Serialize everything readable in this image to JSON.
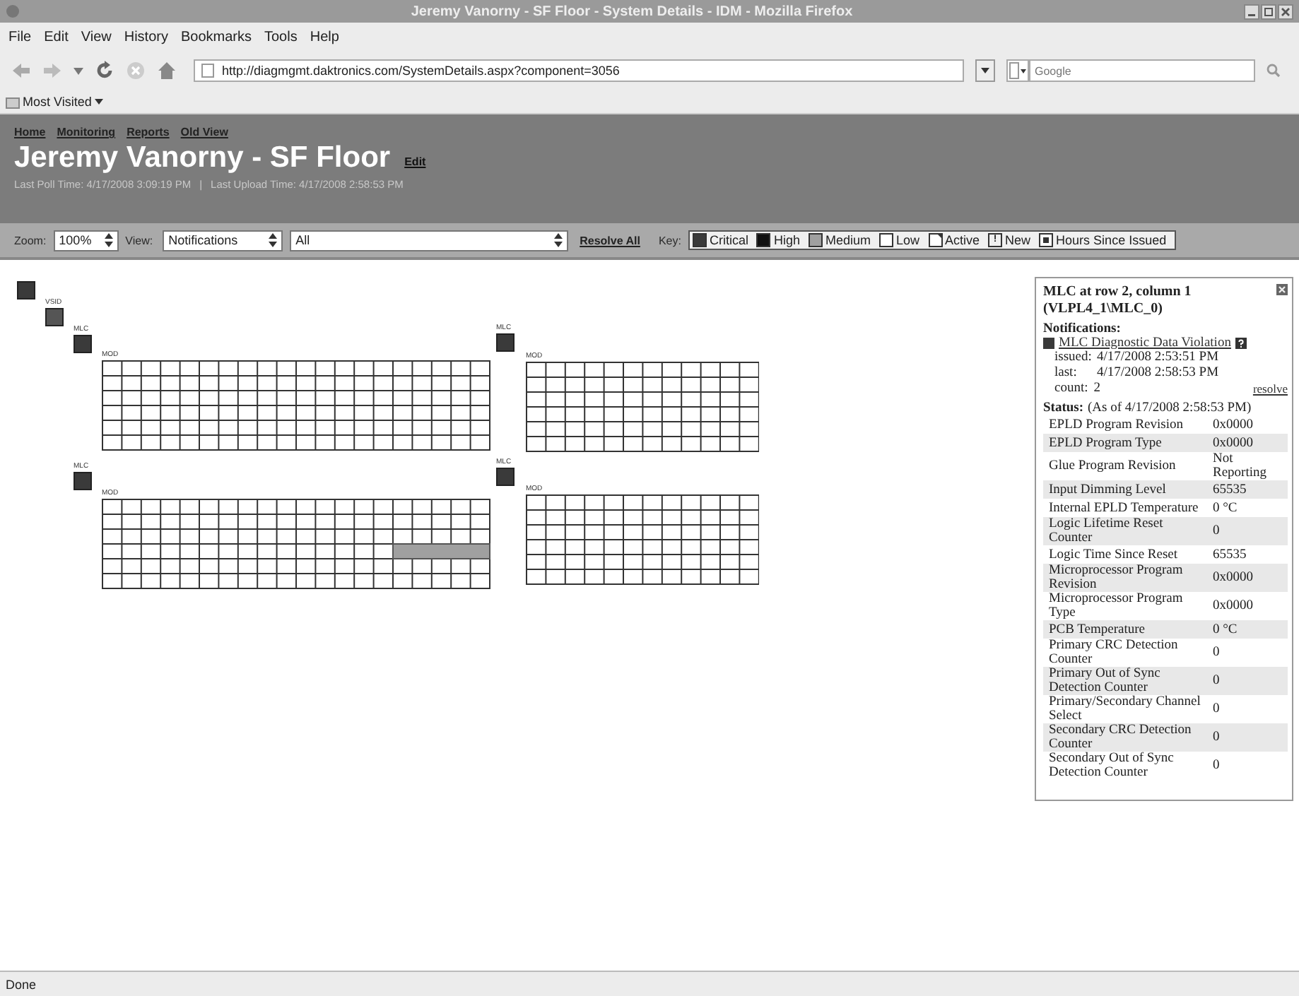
{
  "window": {
    "title": "Jeremy Vanorny - SF Floor - System Details - IDM - Mozilla Firefox"
  },
  "menu": [
    "File",
    "Edit",
    "View",
    "History",
    "Bookmarks",
    "Tools",
    "Help"
  ],
  "address": {
    "url": "http://diagmgmt.daktronics.com/SystemDetails.aspx?component=3056"
  },
  "search": {
    "placeholder": "Google"
  },
  "bookmarks": [
    "Most Visited"
  ],
  "header": {
    "nav_links": [
      "Home",
      "Monitoring",
      "Reports",
      "Old View"
    ],
    "title": "Jeremy Vanorny - SF Floor",
    "edit_link": "Edit",
    "last_poll": "Last Poll Time: 4/17/2008 3:09:19 PM",
    "separator": "|",
    "last_upload": "Last Upload Time: 4/17/2008 2:58:53 PM"
  },
  "toolbar": {
    "zoom_label": "Zoom:",
    "zoom": "100%",
    "view_label": "View:",
    "view": "Notifications",
    "filter": "All",
    "resolve_all": "Resolve All",
    "key_label": "Key:",
    "key": [
      {
        "kind": "swatch",
        "label": "Critical",
        "color": "#3a3a3a"
      },
      {
        "kind": "swatch",
        "label": "High",
        "color": "#111111"
      },
      {
        "kind": "swatch",
        "label": "Medium",
        "color": "#a0a0a0"
      },
      {
        "kind": "swatch",
        "label": "Low",
        "color": "#ffffff"
      },
      {
        "kind": "active",
        "label": "Active"
      },
      {
        "kind": "new",
        "label": "New",
        "mark": "!"
      },
      {
        "kind": "hours",
        "label": "Hours Since Issued"
      }
    ]
  },
  "diagram": {
    "nodes": [
      {
        "kind": "unit",
        "color": "#3a3a3a"
      },
      {
        "kind": "unit",
        "label": "VSID",
        "color": "#555555"
      },
      {
        "kind": "unit",
        "label": "MLC",
        "color": "#3a3a3a"
      },
      {
        "kind": "module",
        "label": "MOD",
        "alert": false
      },
      {
        "kind": "unit",
        "label": "MLC",
        "color": "#3a3a3a"
      },
      {
        "kind": "module",
        "label": "MOD",
        "alert": false
      },
      {
        "kind": "unit",
        "label": "MLC",
        "color": "#3a3a3a"
      },
      {
        "kind": "module",
        "label": "MOD",
        "alert": true
      },
      {
        "kind": "unit",
        "label": "MLC",
        "color": "#3a3a3a"
      },
      {
        "kind": "module",
        "label": "MOD",
        "alert": false
      }
    ]
  },
  "panel": {
    "title": "MLC at row 2, column 1",
    "subtitle": "(VLPL4_1\\MLC_0)",
    "notifications_heading": "Notifications:",
    "notification": {
      "color": "#3a3a3a",
      "link": "MLC Diagnostic Data Violation",
      "issued_label": "issued:",
      "issued": "4/17/2008 2:53:51 PM",
      "last_label": "last:",
      "last": "4/17/2008 2:58:53 PM",
      "count_label": "count:",
      "count": "2",
      "resolve": "resolve"
    },
    "status_heading": "Status:",
    "status_time": "(As of 4/17/2008 2:58:53 PM)",
    "status": [
      {
        "name": "EPLD Program Revision",
        "value": "0x0000"
      },
      {
        "name": "EPLD Program Type",
        "value": "0x0000"
      },
      {
        "name": "Glue Program Revision",
        "value": "Not Reporting"
      },
      {
        "name": "Input Dimming Level",
        "value": "65535"
      },
      {
        "name": "Internal EPLD Temperature",
        "value": "0 °C"
      },
      {
        "name": "Logic Lifetime Reset Counter",
        "value": "0"
      },
      {
        "name": "Logic Time Since Reset",
        "value": "65535"
      },
      {
        "name": "Microprocessor Program Revision",
        "value": "0x0000"
      },
      {
        "name": "Microprocessor Program Type",
        "value": "0x0000"
      },
      {
        "name": "PCB Temperature",
        "value": "0 °C"
      },
      {
        "name": "Primary CRC Detection Counter",
        "value": "0"
      },
      {
        "name": "Primary Out of Sync Detection Counter",
        "value": "0"
      },
      {
        "name": "Primary/Secondary Channel Select",
        "value": "0"
      },
      {
        "name": "Secondary CRC Detection Counter",
        "value": "0"
      },
      {
        "name": "Secondary Out of Sync Detection Counter",
        "value": "0"
      }
    ]
  },
  "status_bar": {
    "text": "Done"
  }
}
